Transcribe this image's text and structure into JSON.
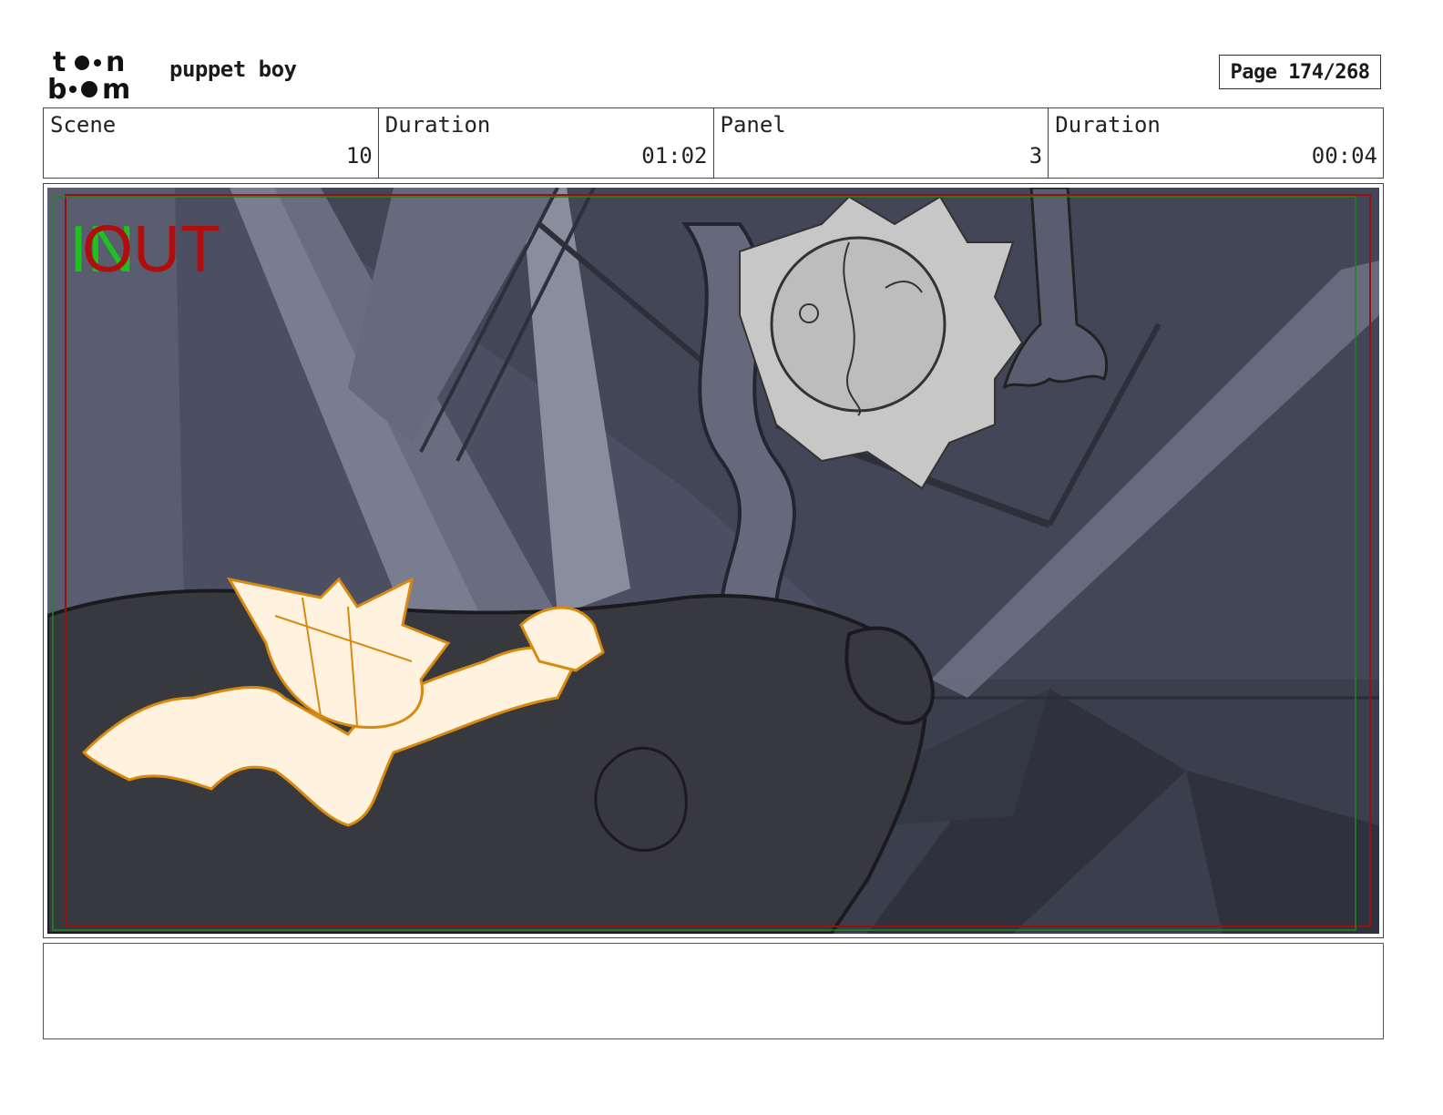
{
  "header": {
    "logo_top": "t●●n",
    "logo_bottom": "b●●m",
    "project_title": "puppet boy",
    "page_label": "Page 174/268"
  },
  "info": {
    "scene_label": "Scene",
    "scene_value": "10",
    "scene_duration_label": "Duration",
    "scene_duration_value": "01:02",
    "panel_label": "Panel",
    "panel_value": "3",
    "panel_duration_label": "Duration",
    "panel_duration_value": "00:04"
  },
  "panel": {
    "in_marker": "IN",
    "out_marker": "OUT"
  },
  "notes": {
    "text": ""
  },
  "colors": {
    "frame_red": "#9a1010",
    "frame_green": "#1a8a1a",
    "character_fill": "#fff3df",
    "character_line": "#d88a10",
    "background": "#4a4e60"
  }
}
